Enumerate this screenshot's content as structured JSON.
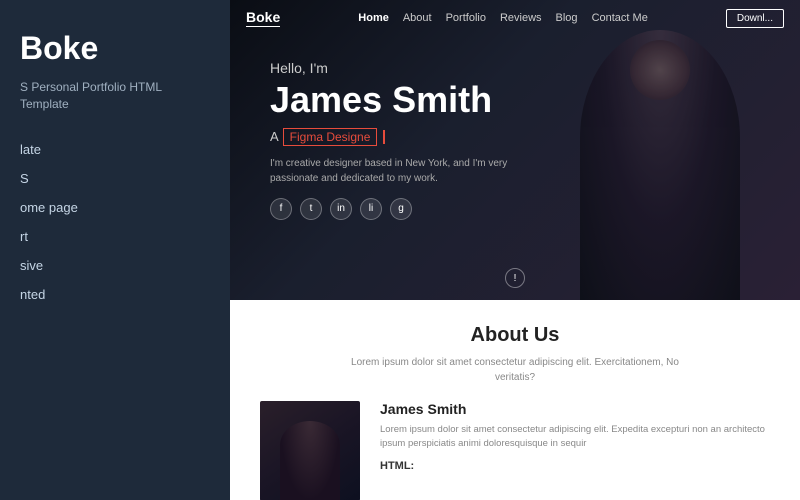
{
  "left_panel": {
    "brand": "Boke",
    "subtitle": "S Personal Portfolio HTML Template",
    "nav_items": [
      {
        "label": "late",
        "id": "template"
      },
      {
        "label": "S",
        "id": "s"
      },
      {
        "label": "ome page",
        "id": "home"
      },
      {
        "label": "rt",
        "id": "start"
      },
      {
        "label": "sive",
        "id": "responsive"
      },
      {
        "label": "nted",
        "id": "documented"
      }
    ]
  },
  "top_nav": {
    "logo": "Boke",
    "links": [
      {
        "label": "Home",
        "active": true
      },
      {
        "label": "About"
      },
      {
        "label": "Portfolio"
      },
      {
        "label": "Reviews"
      },
      {
        "label": "Blog"
      },
      {
        "label": "Contact Me"
      }
    ],
    "download_button": "Downl..."
  },
  "hero": {
    "greeting": "Hello, I'm",
    "name": "James Smith",
    "role_prefix": "A",
    "role": "Figma Designe",
    "description": "I'm creative designer based in New York, and I'm very passionate and dedicated to my work.",
    "social_icons": [
      {
        "name": "facebook",
        "symbol": "f"
      },
      {
        "name": "twitter",
        "symbol": "t"
      },
      {
        "name": "instagram",
        "symbol": "in"
      },
      {
        "name": "linkedin",
        "symbol": "li"
      },
      {
        "name": "github",
        "symbol": "g"
      }
    ],
    "scroll_symbol": "!"
  },
  "about": {
    "title": "About Us",
    "description": "Lorem ipsum dolor sit amet consectetur adipiscing elit. Exercitationem, No veritatis?",
    "person_name": "James Smith",
    "person_description": "Lorem ipsum dolor sit amet consectetur adipiscing elit. Expedita excepturi non an architecto ipsum perspiciatis animi doloresquisque in sequir",
    "html_label": "HTML:"
  }
}
